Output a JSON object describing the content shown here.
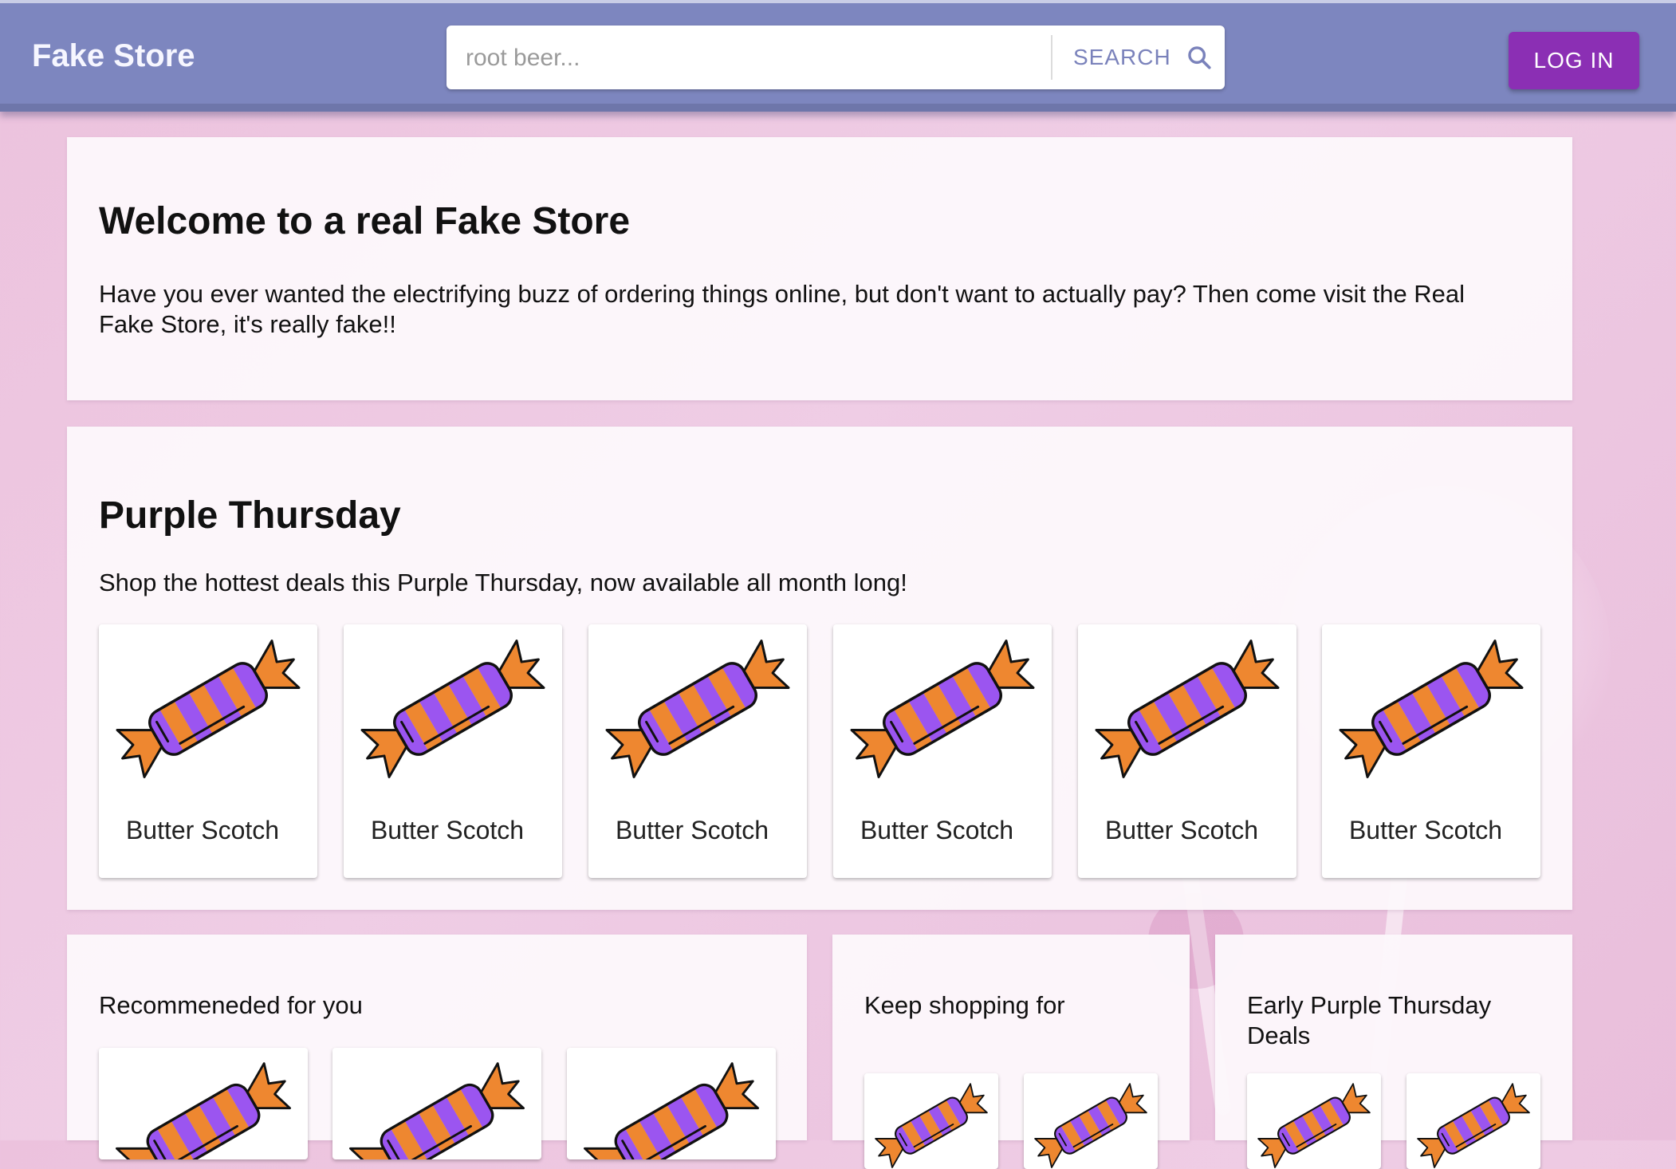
{
  "header": {
    "brand": "Fake Store",
    "search_placeholder": "root beer...",
    "search_button": "SEARCH",
    "login_button": "LOG IN"
  },
  "welcome": {
    "title": "Welcome to a real Fake Store",
    "body": "Have you ever wanted the electrifying buzz of ordering things online, but don't want to actually pay? Then come visit the Real Fake Store, it's really fake!!"
  },
  "deals": {
    "title": "Purple Thursday",
    "subtitle": "Shop the hottest deals this Purple Thursday, now available all month long!",
    "products": [
      {
        "name": "Butter Scotch"
      },
      {
        "name": "Butter Scotch"
      },
      {
        "name": "Butter Scotch"
      },
      {
        "name": "Butter Scotch"
      },
      {
        "name": "Butter Scotch"
      },
      {
        "name": "Butter Scotch"
      }
    ]
  },
  "sections": {
    "recommended": "Recommeneded for you",
    "keep_shopping": "Keep shopping for",
    "early_deals": "Early Purple Thursday Deals"
  },
  "colors": {
    "appbar": "#7d86bf",
    "login": "#8b2fb4",
    "candy_purple": "#9b55f0",
    "candy_orange": "#ee8730"
  },
  "icons": {
    "search": "search-icon",
    "product": "candy-icon"
  }
}
